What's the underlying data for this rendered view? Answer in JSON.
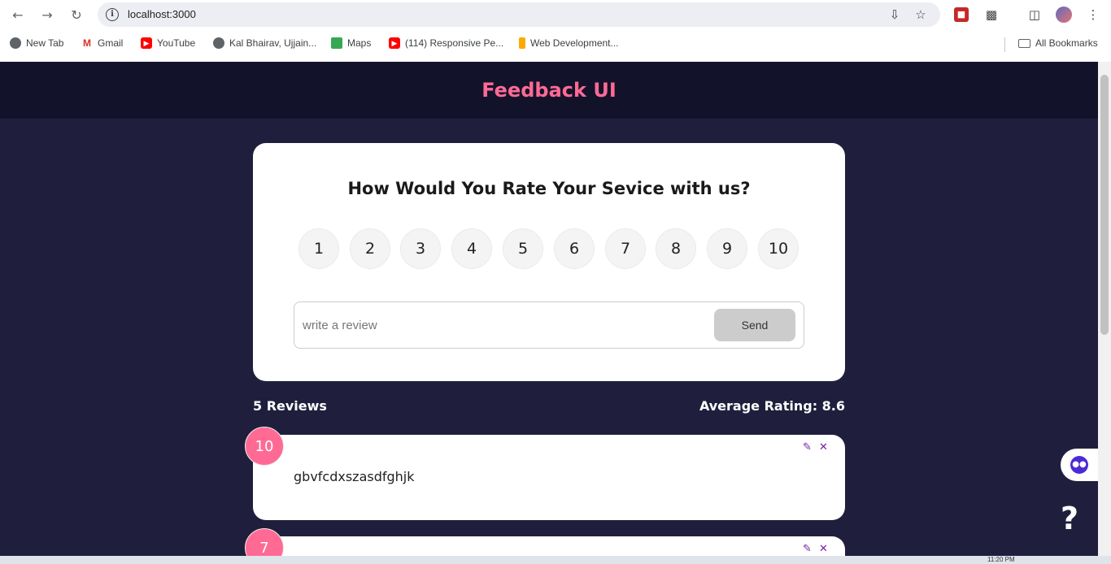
{
  "browser": {
    "url": "localhost:3000",
    "bookmarks": [
      {
        "label": "New Tab",
        "icon": "globe-icon"
      },
      {
        "label": "Gmail",
        "icon": "gmail-icon"
      },
      {
        "label": "YouTube",
        "icon": "youtube-icon"
      },
      {
        "label": "Kal Bhairav, Ujjain...",
        "icon": "globe-icon"
      },
      {
        "label": "Maps",
        "icon": "maps-icon"
      },
      {
        "label": "(114) Responsive Pe...",
        "icon": "youtube-icon"
      },
      {
        "label": "Web Development...",
        "icon": "web-icon"
      }
    ],
    "all_bookmarks": "All Bookmarks"
  },
  "app": {
    "title": "Feedback UI",
    "accent_color": "#ff6a95",
    "rating_card": {
      "question": "How Would You Rate Your Sevice with us?",
      "ratings": [
        "1",
        "2",
        "3",
        "4",
        "5",
        "6",
        "7",
        "8",
        "9",
        "10"
      ],
      "input_placeholder": "write a review",
      "input_value": "",
      "send_label": "Send"
    },
    "stats": {
      "count_label": "5 Reviews",
      "average_label": "Average Rating: 8.6"
    },
    "reviews": [
      {
        "rating": "10",
        "text": "gbvfcdxszasdfghjk"
      },
      {
        "rating": "7",
        "text": ""
      }
    ]
  },
  "widgets": {
    "help_label": "?"
  },
  "taskbar": {
    "time": "11:20 PM"
  }
}
